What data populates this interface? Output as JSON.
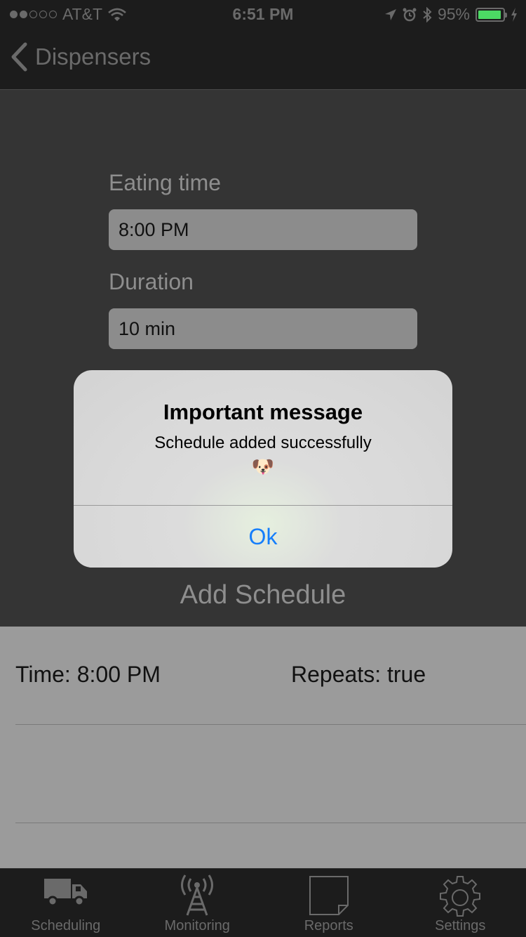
{
  "status_bar": {
    "carrier": "AT&T",
    "time": "6:51 PM",
    "battery_percent": "95%",
    "battery_level": 0.95
  },
  "nav": {
    "back_label": "Dispensers"
  },
  "form": {
    "eating_time_label": "Eating time",
    "eating_time_value": "8:00 PM",
    "duration_label": "Duration",
    "duration_value": "10 min"
  },
  "add_schedule_label": "Add Schedule",
  "schedules": [
    {
      "time": "Time: 8:00 PM",
      "repeats": "Repeats: true"
    }
  ],
  "alert": {
    "title": "Important message",
    "message": "Schedule added successfully",
    "emoji": "🐶",
    "button_label": "Ok"
  },
  "tabs": [
    {
      "label": "Scheduling",
      "icon": "truck-icon"
    },
    {
      "label": "Monitoring",
      "icon": "antenna-icon"
    },
    {
      "label": "Reports",
      "icon": "document-icon"
    },
    {
      "label": "Settings",
      "icon": "gear-icon"
    }
  ],
  "colors": {
    "accent_blue": "#157efb",
    "battery_green": "#4cd964"
  }
}
